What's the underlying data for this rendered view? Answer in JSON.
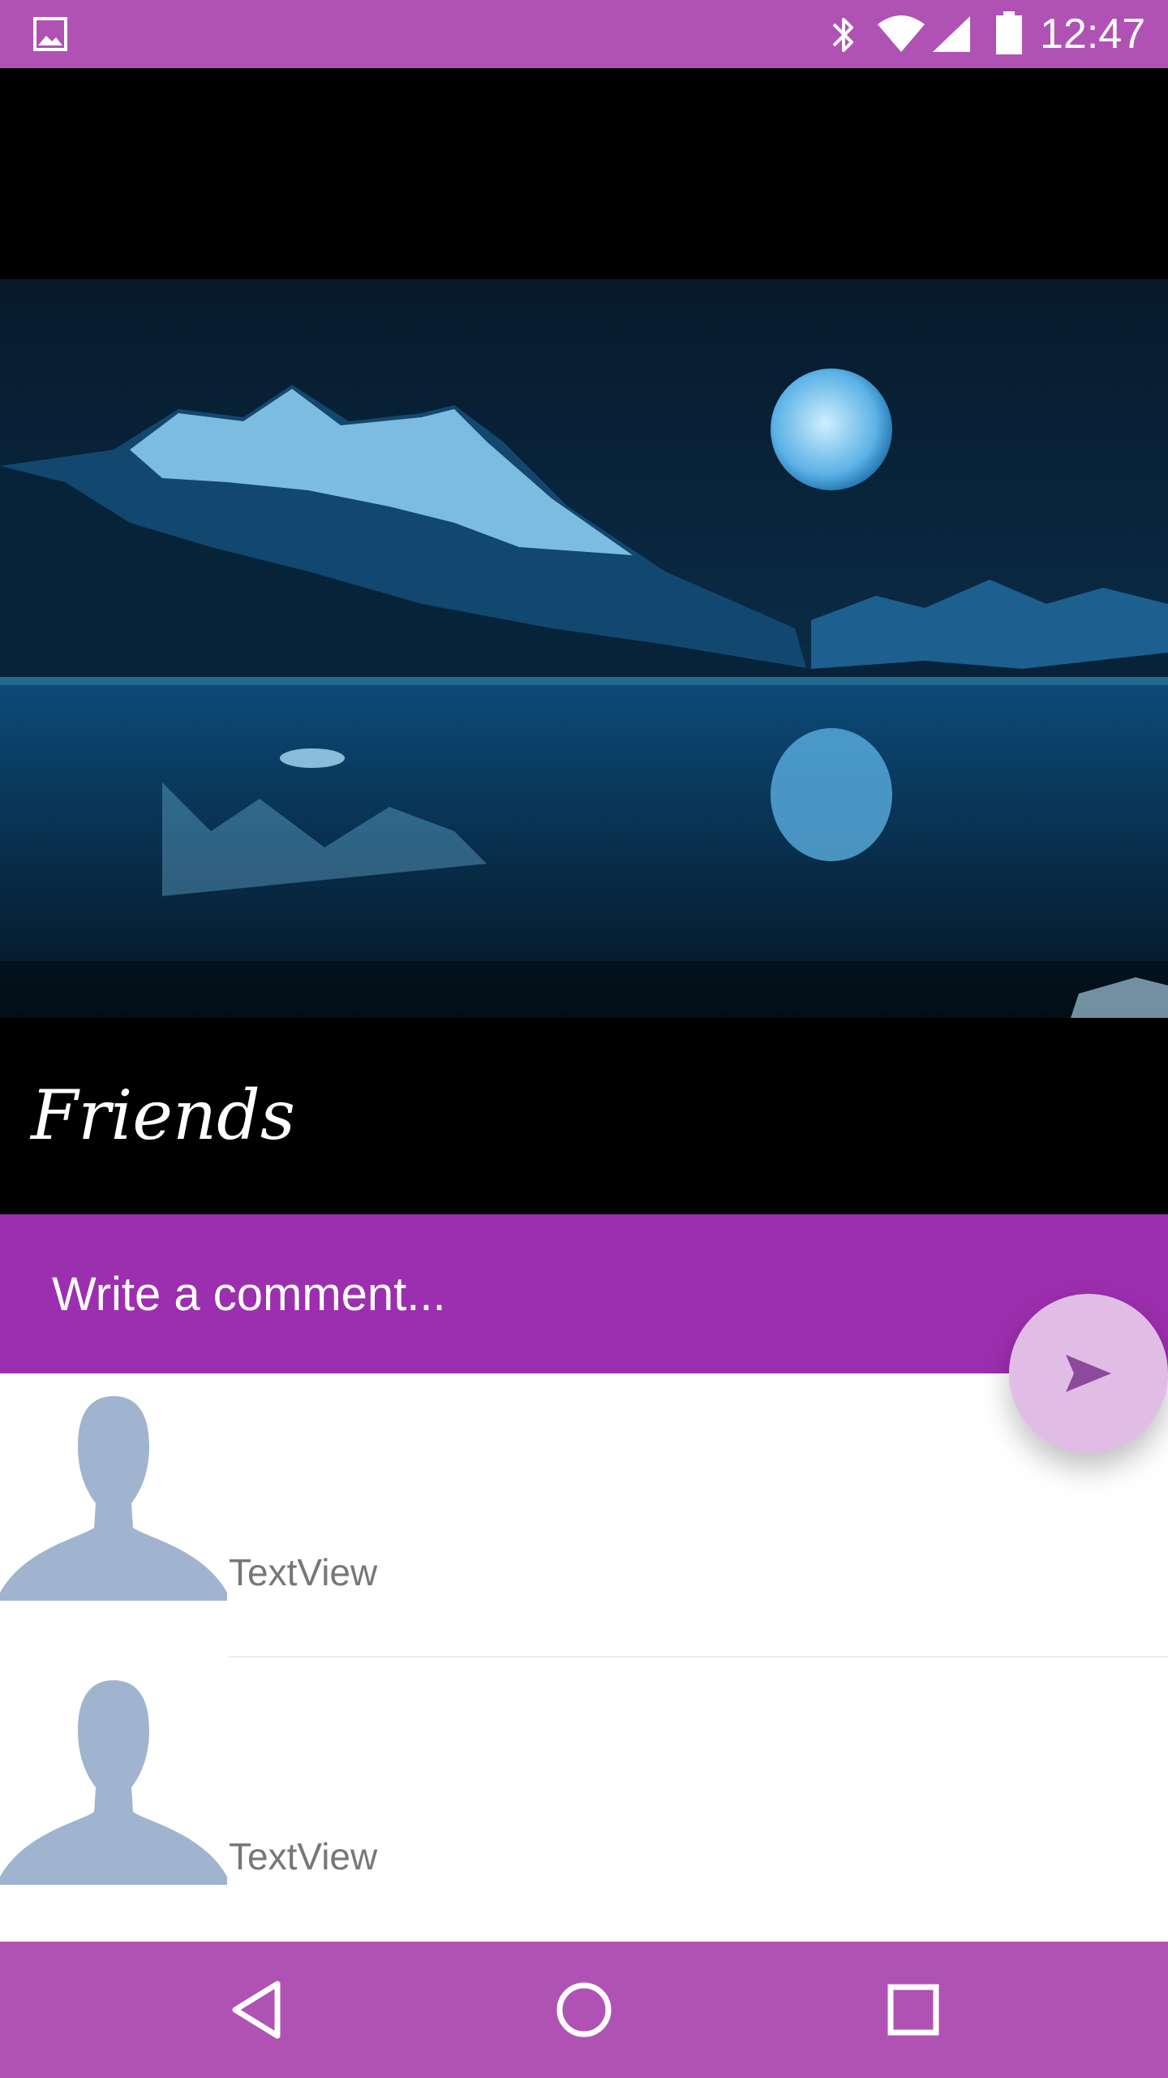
{
  "status_bar": {
    "time": "12:47",
    "icons": [
      "gallery-icon",
      "bluetooth-icon",
      "wifi-icon",
      "signal-icon",
      "battery-icon"
    ]
  },
  "hero": {
    "image": "moonlit-lake-mountains-photo",
    "title": "Friends"
  },
  "comment": {
    "placeholder": "Write a comment...",
    "value": "",
    "send_icon": "send-icon"
  },
  "comments": [
    {
      "avatar": "default-avatar-icon",
      "name": "TextView"
    },
    {
      "avatar": "default-avatar-icon",
      "name": "TextView"
    }
  ],
  "nav_bar": {
    "icons": [
      "back-icon",
      "home-icon",
      "recents-icon"
    ]
  },
  "colors": {
    "status_bar": "#b052b4",
    "comment_bar": "#9c2fae",
    "fab": "#e1bde6",
    "avatar": "#a0b4cf",
    "list_text": "#777777"
  }
}
